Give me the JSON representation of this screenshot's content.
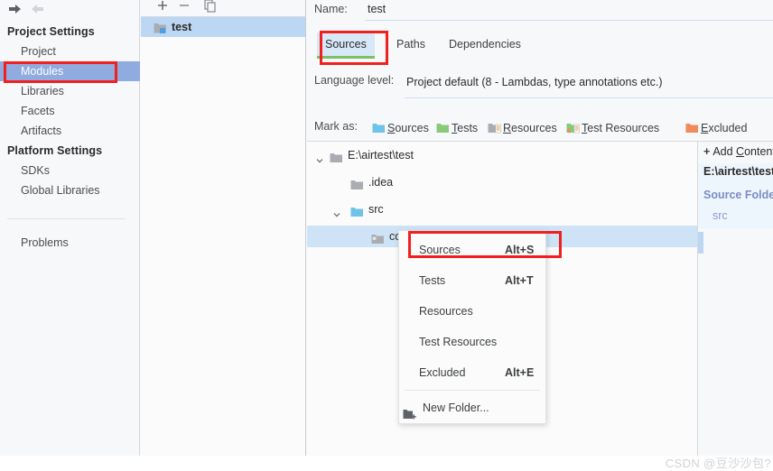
{
  "sidebar": {
    "nav": {
      "back": "back-arrow",
      "forward": "forward-arrow"
    },
    "groups": [
      {
        "header": "Project Settings",
        "items": [
          {
            "label": "Project",
            "selected": false
          },
          {
            "label": "Modules",
            "selected": true
          },
          {
            "label": "Libraries",
            "selected": false
          },
          {
            "label": "Facets",
            "selected": false
          },
          {
            "label": "Artifacts",
            "selected": false
          }
        ]
      },
      {
        "header": "Platform Settings",
        "items": [
          {
            "label": "SDKs",
            "selected": false
          },
          {
            "label": "Global Libraries",
            "selected": false
          }
        ]
      }
    ],
    "problems": "Problems"
  },
  "module_list": {
    "toolbar": [
      {
        "icon": "plus-icon",
        "label": "+"
      },
      {
        "icon": "minus-icon",
        "label": "−"
      },
      {
        "icon": "copy-icon",
        "label": "copy"
      }
    ],
    "rows": [
      {
        "label": "test",
        "icon": "module-folder-icon",
        "selected": true
      }
    ]
  },
  "main": {
    "name_label": "Name:",
    "name_value": "test",
    "tabs": [
      {
        "label": "Sources",
        "active": true
      },
      {
        "label": "Paths",
        "active": false
      },
      {
        "label": "Dependencies",
        "active": false
      }
    ],
    "language_level_label": "Language level:",
    "language_level_value": "Project default (8 - Lambdas, type annotations etc.)",
    "mark_as_label": "Mark as:",
    "mark_as_items": [
      {
        "label": "Sources",
        "mnemonic": "S",
        "icon": "sources-folder-icon",
        "color": "#6fc2e8"
      },
      {
        "label": "Tests",
        "mnemonic": "T",
        "icon": "tests-folder-icon",
        "color": "#89c97a"
      },
      {
        "label": "Resources",
        "mnemonic": "R",
        "icon": "resources-folder-icon",
        "color": "#a9adb2"
      },
      {
        "label": "Test Resources",
        "mnemonic": "T",
        "icon": "test-resources-folder-icon",
        "color": "#89c97a"
      },
      {
        "label": "Excluded",
        "mnemonic": "E",
        "icon": "excluded-folder-icon",
        "color": "#ef8b5e"
      }
    ]
  },
  "tree": {
    "rows": [
      {
        "label": "E:\\airtest\\test",
        "depth": 0,
        "twisty": "expanded",
        "icon": "folder-gray-icon",
        "selected": false
      },
      {
        "label": ".idea",
        "depth": 1,
        "twisty": "none",
        "icon": "folder-gray-icon",
        "selected": false
      },
      {
        "label": "src",
        "depth": 1,
        "twisty": "expanded",
        "icon": "folder-blue-icon",
        "selected": false
      },
      {
        "label": "com",
        "depth": 2,
        "twisty": "none",
        "icon": "folder-module-icon",
        "selected": true
      }
    ]
  },
  "right_panel": {
    "add_content_root": "Add Content Root",
    "add_content_root_mnemonic": "C",
    "root_path": "E:\\airtest\\test",
    "source_folders_header": "Source Folders",
    "source_folders": [
      "src"
    ]
  },
  "context_menu": {
    "items": [
      {
        "label": "Sources",
        "shortcut": "Alt+S",
        "highlighted": true
      },
      {
        "label": "Tests",
        "shortcut": "Alt+T",
        "highlighted": false
      },
      {
        "label": "Resources",
        "shortcut": "",
        "highlighted": false
      },
      {
        "label": "Test Resources",
        "shortcut": "",
        "highlighted": false
      },
      {
        "label": "Excluded",
        "shortcut": "Alt+E",
        "highlighted": false
      }
    ],
    "new_folder": {
      "label": "New Folder...",
      "icon": "new-folder-icon"
    }
  },
  "annotations": {
    "color": "#f21f1f",
    "boxes": [
      "modules-sidebar-item",
      "sources-tab",
      "context-menu-sources-item"
    ]
  },
  "watermark": "CSDN @豆沙沙包?"
}
